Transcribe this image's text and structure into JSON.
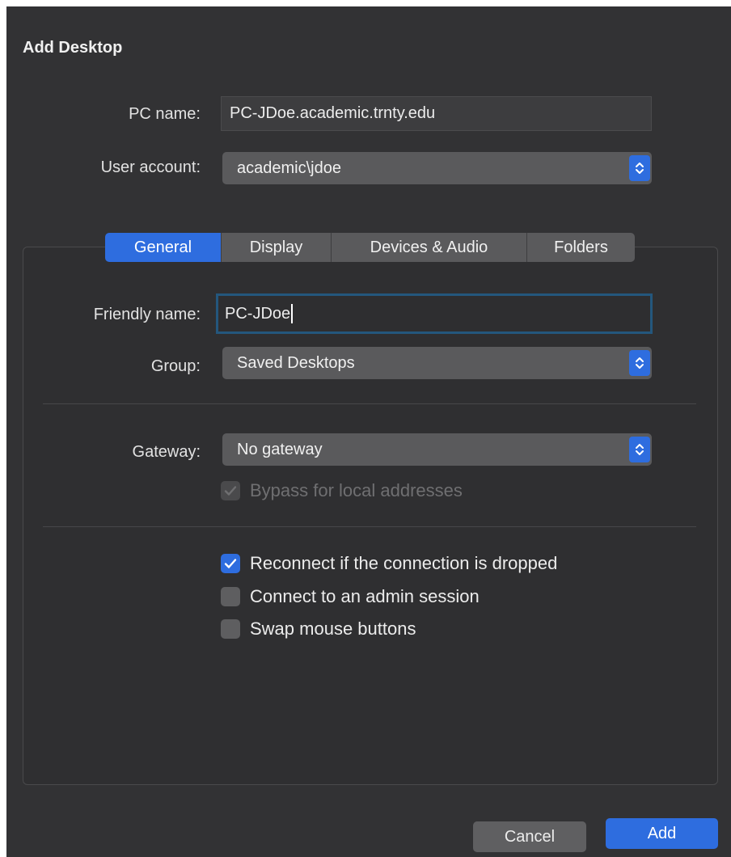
{
  "dialog": {
    "title": "Add Desktop"
  },
  "connection": {
    "pc_name_label": "PC name:",
    "pc_name_value": "PC-JDoe.academic.trnty.edu",
    "user_account_label": "User account:",
    "user_account_value": "academic\\jdoe"
  },
  "tabs": [
    {
      "label": "General",
      "active": true
    },
    {
      "label": "Display",
      "active": false
    },
    {
      "label": "Devices & Audio",
      "active": false
    },
    {
      "label": "Folders",
      "active": false
    }
  ],
  "general": {
    "friendly_name_label": "Friendly name:",
    "friendly_name_value": "PC-JDoe",
    "group_label": "Group:",
    "group_value": "Saved Desktops",
    "gateway_label": "Gateway:",
    "gateway_value": "No gateway",
    "bypass_label": "Bypass for local addresses",
    "bypass_checked": true,
    "bypass_enabled": false,
    "options": [
      {
        "label": "Reconnect if the connection is dropped",
        "checked": true
      },
      {
        "label": "Connect to an admin session",
        "checked": false
      },
      {
        "label": "Swap mouse buttons",
        "checked": false
      }
    ]
  },
  "buttons": {
    "cancel": "Cancel",
    "add": "Add"
  },
  "colors": {
    "window_background": "#323234",
    "accent": "#2e6ddf",
    "focus_ring": "#24577d",
    "control_background": "#5a5a5c"
  },
  "icons": {
    "popup_arrows": "chevron-up-down-icon",
    "checkmark": "checkmark-icon"
  }
}
